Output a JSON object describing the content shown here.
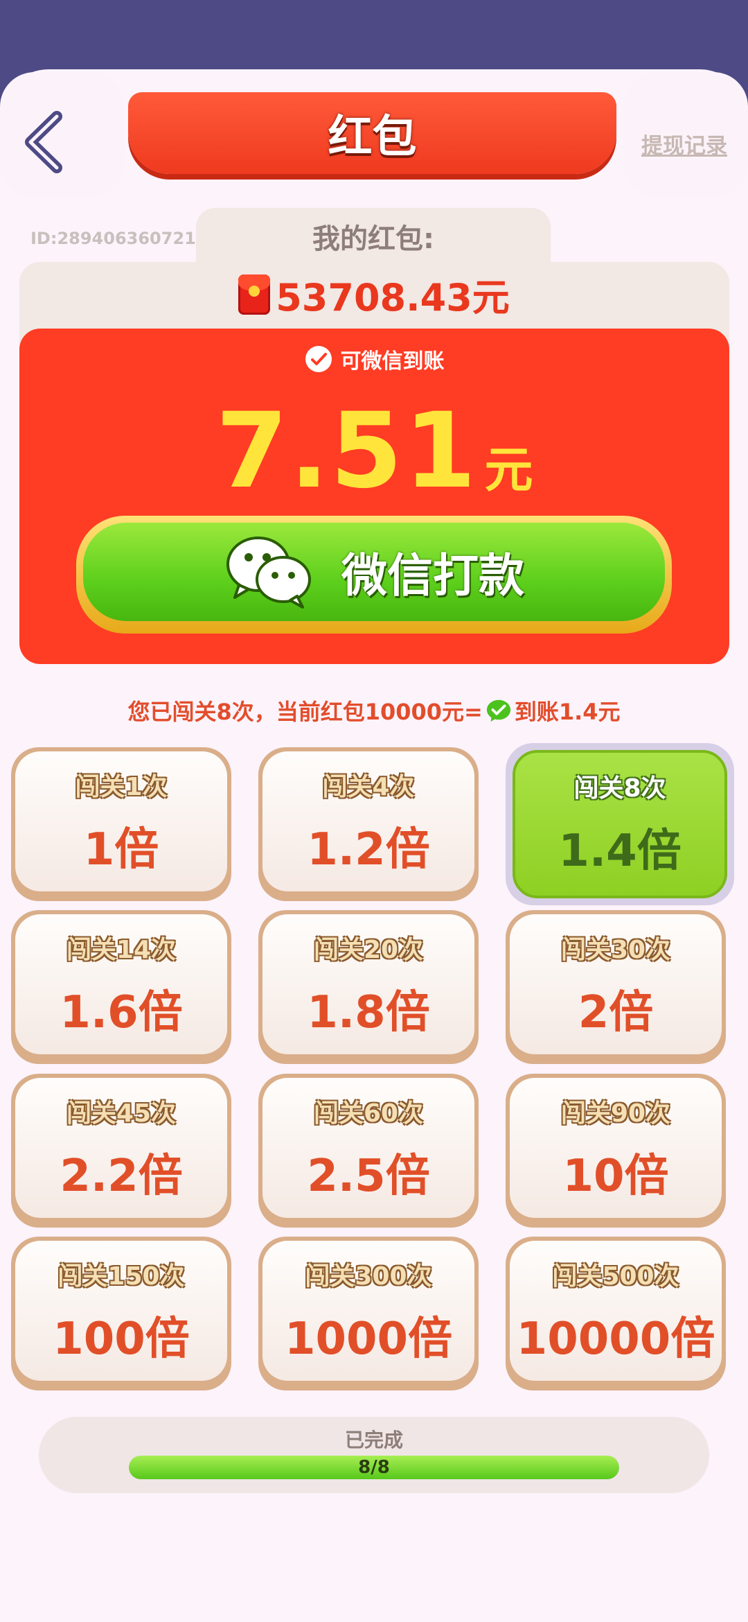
{
  "header": {
    "title": "红包",
    "withdraw_records": "提现记录"
  },
  "wallet": {
    "user_id": "ID:289406360721",
    "label": "我的红包:",
    "amount": "53708.43元"
  },
  "cashout": {
    "subtitle": "可微信到账",
    "amount": "7.51",
    "unit": "元",
    "button_label": "微信打款"
  },
  "note": {
    "before_icon": "您已闯关8次，当前红包10000元=",
    "after_icon": "到账1.4元"
  },
  "tiers": [
    {
      "label": "闯关1次",
      "value": "1倍",
      "active": false
    },
    {
      "label": "闯关4次",
      "value": "1.2倍",
      "active": false
    },
    {
      "label": "闯关8次",
      "value": "1.4倍",
      "active": true
    },
    {
      "label": "闯关14次",
      "value": "1.6倍",
      "active": false
    },
    {
      "label": "闯关20次",
      "value": "1.8倍",
      "active": false
    },
    {
      "label": "闯关30次",
      "value": "2倍",
      "active": false
    },
    {
      "label": "闯关45次",
      "value": "2.2倍",
      "active": false
    },
    {
      "label": "闯关60次",
      "value": "2.5倍",
      "active": false
    },
    {
      "label": "闯关90次",
      "value": "10倍",
      "active": false
    },
    {
      "label": "闯关150次",
      "value": "100倍",
      "active": false
    },
    {
      "label": "闯关300次",
      "value": "1000倍",
      "active": false
    },
    {
      "label": "闯关500次",
      "value": "10000倍",
      "active": false
    }
  ],
  "progress": {
    "label": "已完成",
    "text": "8/8",
    "fraction": 1.0
  },
  "colors": {
    "header_bg": "#4d4a86",
    "accent_red": "#ff3c24",
    "amount_yellow": "#ffe53b",
    "button_green": "#5dcf1c",
    "active_tile": "#8fd024"
  }
}
